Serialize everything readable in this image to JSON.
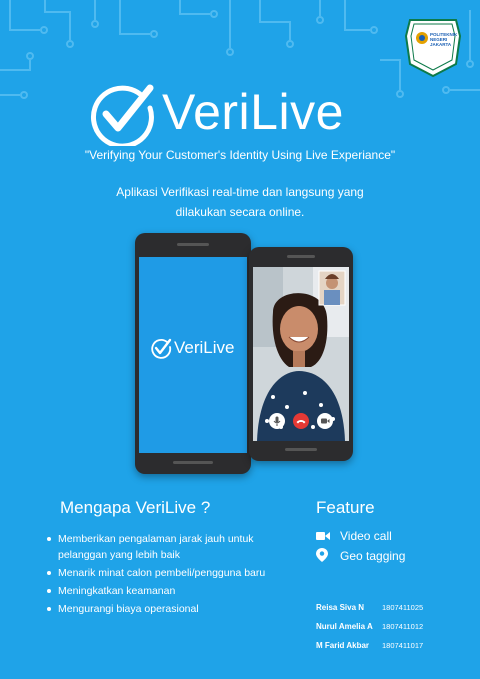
{
  "brand": {
    "name": "VeriLive",
    "small_name": "VeriLive"
  },
  "institution": {
    "name": "POLITEKNIK NEGERI JAKARTA"
  },
  "tagline": "\"Verifying Your Customer's Identity Using Live Experiance\"",
  "description": "Aplikasi Verifikasi real-time dan langsung yang dilakukan secara online.",
  "why": {
    "heading": "Mengapa VeriLive ?",
    "items": [
      "Memberikan pengalaman jarak jauh untuk pelanggan yang lebih baik",
      "Menarik minat calon pembeli/pengguna baru",
      "Meningkatkan keamanan",
      "Mengurangi biaya operasional"
    ]
  },
  "feature": {
    "heading": "Feature",
    "items": [
      {
        "label": "Video call",
        "icon": "video-camera-icon"
      },
      {
        "label": "Geo tagging",
        "icon": "map-pin-icon"
      }
    ]
  },
  "team": [
    {
      "name": "Reisa Siva N",
      "nim": "1807411025"
    },
    {
      "name": "Nurul Amelia A",
      "nim": "1807411012"
    },
    {
      "name": "M Farid Akbar",
      "nim": "1807411017"
    }
  ],
  "colors": {
    "background": "#1fa3e8",
    "text": "#ffffff",
    "end_call": "#e53935"
  }
}
